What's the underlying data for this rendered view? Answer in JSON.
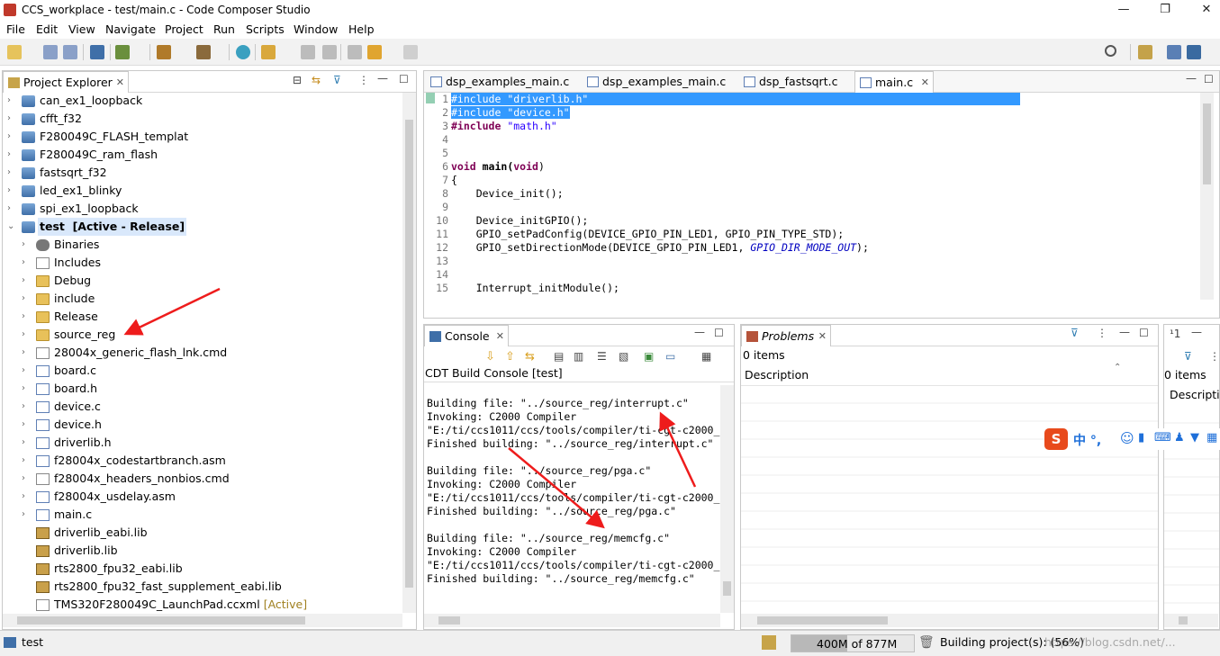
{
  "window": {
    "title": "CCS_workplace - test/main.c - Code Composer Studio"
  },
  "menu": [
    "File",
    "Edit",
    "View",
    "Navigate",
    "Project",
    "Run",
    "Scripts",
    "Window",
    "Help"
  ],
  "project_explorer": {
    "title": "Project Explorer",
    "projects": [
      "can_ex1_loopback",
      "cfft_f32",
      "F280049C_FLASH_templat",
      "F280049C_ram_flash",
      "fastsqrt_f32",
      "led_ex1_blinky",
      "spi_ex1_loopback"
    ],
    "active_project": {
      "name": "test",
      "status": "[Active - Release]"
    },
    "children": [
      {
        "label": "Binaries",
        "icon": "binaries-icon"
      },
      {
        "label": "Includes",
        "icon": "includes-icon"
      },
      {
        "label": "Debug",
        "icon": "folder-icon"
      },
      {
        "label": "include",
        "icon": "folder-icon"
      },
      {
        "label": "Release",
        "icon": "folder-icon"
      },
      {
        "label": "source_reg",
        "icon": "folder-icon"
      },
      {
        "label": "28004x_generic_flash_lnk.cmd",
        "icon": "cmd-file-icon"
      },
      {
        "label": "board.c",
        "icon": "c-file-icon"
      },
      {
        "label": "board.h",
        "icon": "h-file-icon"
      },
      {
        "label": "device.c",
        "icon": "c-file-icon"
      },
      {
        "label": "device.h",
        "icon": "h-file-icon"
      },
      {
        "label": "driverlib.h",
        "icon": "h-file-icon"
      },
      {
        "label": "f28004x_codestartbranch.asm",
        "icon": "asm-file-icon"
      },
      {
        "label": "f28004x_headers_nonbios.cmd",
        "icon": "cmd-file-icon"
      },
      {
        "label": "f28004x_usdelay.asm",
        "icon": "asm-file-icon"
      },
      {
        "label": "main.c",
        "icon": "c-file-icon"
      },
      {
        "label": "driverlib_eabi.lib",
        "icon": "lib-icon"
      },
      {
        "label": "driverlib.lib",
        "icon": "lib-icon"
      },
      {
        "label": "rts2800_fpu32_eabi.lib",
        "icon": "lib-icon"
      },
      {
        "label": "rts2800_fpu32_fast_supplement_eabi.lib",
        "icon": "lib-icon"
      },
      {
        "label": "TMS320F280049C_LaunchPad.ccxml",
        "icon": "ccxml-icon"
      }
    ],
    "active_suffix": "[Active]"
  },
  "editor": {
    "tabs": [
      "dsp_examples_main.c",
      "dsp_examples_main.c",
      "dsp_fastsqrt.c",
      "main.c"
    ],
    "active_tab": "main.c"
  },
  "code": {
    "l1_pp": "#include",
    "l1_str": "\"driverlib.h\"",
    "l2_pp": "#include",
    "l2_str": "\"device.h\"",
    "l3_pp": "#include",
    "l3_str": "\"math.h\"",
    "l6_kw": "void",
    "l6_fn": " main(",
    "l6_kw2": "void",
    "l6_end": ")",
    "l7": "{",
    "l8": "    Device_init();",
    "l10": "    Device_initGPIO();",
    "l11": "    GPIO_setPadConfig(DEVICE_GPIO_PIN_LED1, GPIO_PIN_TYPE_STD);",
    "l12_a": "    GPIO_setDirectionMode(DEVICE_GPIO_PIN_LED1, ",
    "l12_b": "GPIO_DIR_MODE_OUT",
    "l12_c": ");",
    "l15": "    Interrupt_initModule();"
  },
  "console": {
    "title": "Console",
    "subtitle": "CDT Build Console [test]",
    "lines": [
      "Building file: \"../source_reg/interrupt.c\"",
      "Invoking: C2000 Compiler",
      "\"E:/ti/ccs1011/ccs/tools/compiler/ti-cgt-c2000_",
      "Finished building: \"../source_reg/interrupt.c\"",
      "",
      "Building file: \"../source_reg/pga.c\"",
      "Invoking: C2000 Compiler",
      "\"E:/ti/ccs1011/ccs/tools/compiler/ti-cgt-c2000_",
      "Finished building: \"../source_reg/pga.c\"",
      "",
      "Building file: \"../source_reg/memcfg.c\"",
      "Invoking: C2000 Compiler",
      "\"E:/ti/ccs1011/ccs/tools/compiler/ti-cgt-c2000_",
      "Finished building: \"../source_reg/memcfg.c\""
    ]
  },
  "problems": {
    "title": "Problems",
    "count": "0 items",
    "column": "Description"
  },
  "right_panel": {
    "count": "0 items",
    "column": "Descriptio",
    "tab_label": "¹1"
  },
  "ime": {
    "chars": "中 °,"
  },
  "status": {
    "selected": "test",
    "heap": "400M of 877M",
    "job": "Building project(s): (56%)",
    "watermark": "https://blog.csdn.net/..."
  }
}
